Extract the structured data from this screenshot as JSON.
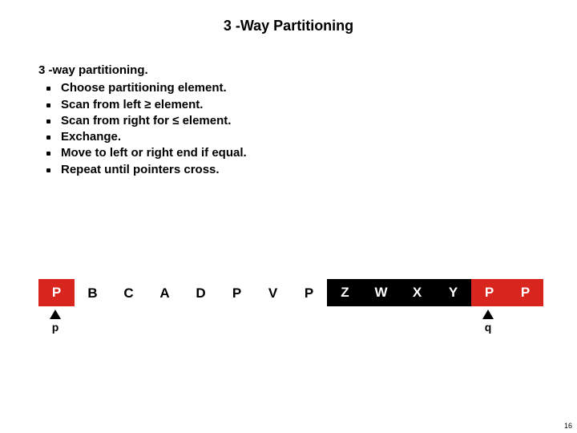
{
  "title": "3 -Way Partitioning",
  "heading": "3 -way partitioning.",
  "bullets": [
    "Choose partitioning element.",
    "Scan from left ≥ element.",
    "Scan from right for ≤  element.",
    "Exchange.",
    "Move to left or right end if equal.",
    "Repeat until pointers cross."
  ],
  "array": [
    {
      "v": "P",
      "c": "red"
    },
    {
      "v": "B",
      "c": "white"
    },
    {
      "v": "C",
      "c": "white"
    },
    {
      "v": "A",
      "c": "white"
    },
    {
      "v": "D",
      "c": "white"
    },
    {
      "v": "P",
      "c": "white"
    },
    {
      "v": "V",
      "c": "white"
    },
    {
      "v": "P",
      "c": "white"
    },
    {
      "v": "Z",
      "c": "black"
    },
    {
      "v": "W",
      "c": "black"
    },
    {
      "v": "X",
      "c": "black"
    },
    {
      "v": "Y",
      "c": "black"
    },
    {
      "v": "P",
      "c": "red"
    },
    {
      "v": "P",
      "c": "red"
    }
  ],
  "pointers": {
    "p": {
      "label": "p",
      "index": 0
    },
    "q": {
      "label": "q",
      "index": 12
    }
  },
  "pagenum": "16"
}
